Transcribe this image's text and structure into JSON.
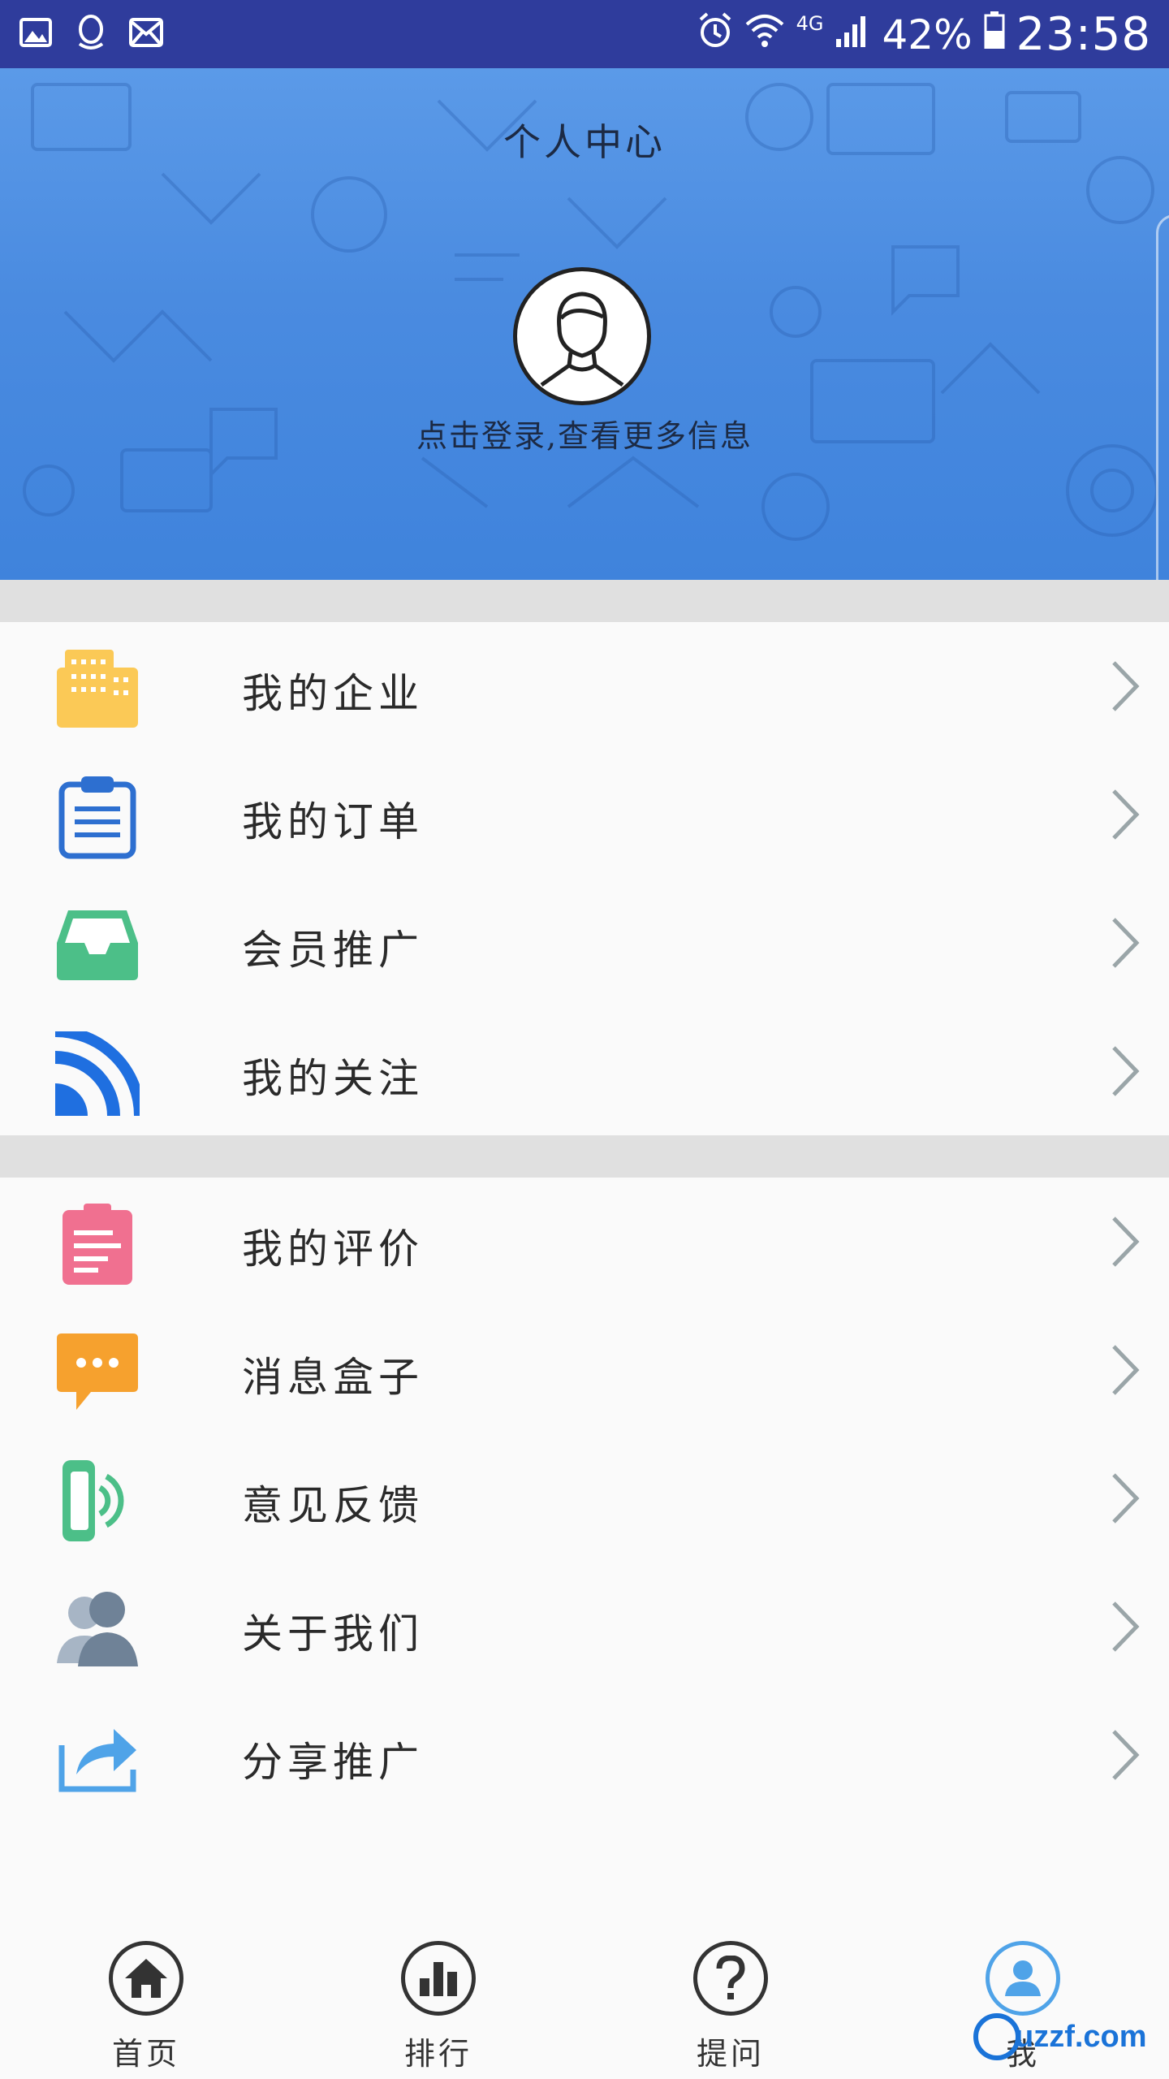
{
  "status_bar": {
    "battery_percent": "42%",
    "time": "23:58",
    "network": "4G",
    "icons": [
      "image-icon",
      "qq-icon",
      "mail-icon",
      "alarm-icon",
      "wifi-icon",
      "signal-icon",
      "battery-icon"
    ]
  },
  "header": {
    "title": "个人中心",
    "login_prompt": "点击登录,查看更多信息",
    "background_color": "#4a8be0"
  },
  "menu_group_1": [
    {
      "label": "我的企业",
      "icon": "building-icon",
      "color": "#fbc956"
    },
    {
      "label": "我的订单",
      "icon": "clipboard-list-icon",
      "color": "#2d6fd0"
    },
    {
      "label": "会员推广",
      "icon": "inbox-tray-icon",
      "color": "#4cbf88"
    },
    {
      "label": "我的关注",
      "icon": "rss-feed-icon",
      "color": "#1f6fe0"
    }
  ],
  "menu_group_2": [
    {
      "label": "我的评价",
      "icon": "review-clipboard-icon",
      "color": "#f07090"
    },
    {
      "label": "消息盒子",
      "icon": "chat-bubble-icon",
      "color": "#f6a12e"
    },
    {
      "label": "意见反馈",
      "icon": "phone-feedback-icon",
      "color": "#4cbf88"
    },
    {
      "label": "关于我们",
      "icon": "users-icon",
      "color": "#8a9bb0"
    },
    {
      "label": "分享推广",
      "icon": "share-icon",
      "color": "#4fa3e8"
    }
  ],
  "bottom_nav": [
    {
      "label": "首页",
      "icon": "home-icon",
      "active": false
    },
    {
      "label": "排行",
      "icon": "bar-chart-icon",
      "active": false
    },
    {
      "label": "提问",
      "icon": "question-icon",
      "active": false
    },
    {
      "label": "我",
      "icon": "user-icon",
      "active": true
    }
  ],
  "watermark": {
    "text": "uzzf.com"
  }
}
